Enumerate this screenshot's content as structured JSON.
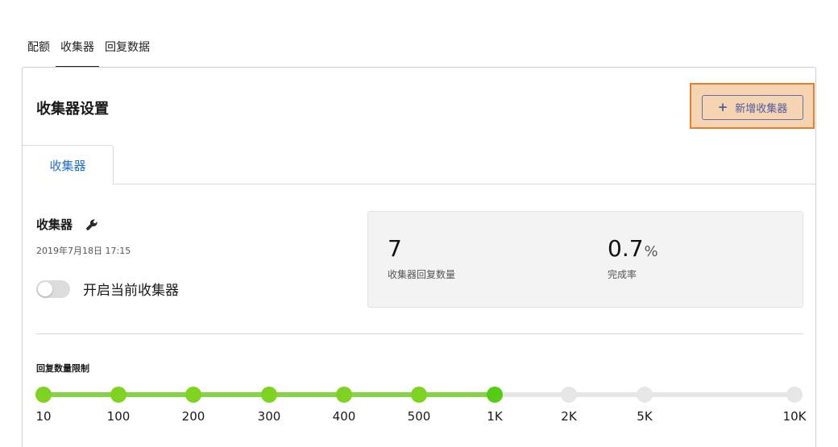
{
  "top_tabs": [
    {
      "label": "配额",
      "active": false
    },
    {
      "label": "收集器",
      "active": true
    },
    {
      "label": "回复数据",
      "active": false
    }
  ],
  "card": {
    "title": "收集器设置",
    "add_button_label": "新增收集器",
    "add_button_icon": "plus-icon"
  },
  "inner_tabs": [
    {
      "label": "收集器",
      "active": true
    }
  ],
  "collector": {
    "name": "收集器",
    "edit_icon": "wrench-icon",
    "date": "2019年7月18日 17:15",
    "toggle_label": "开启当前收集器",
    "toggle_on": false
  },
  "stats": [
    {
      "value": "7",
      "unit": "",
      "label": "收集器回复数量"
    },
    {
      "value": "0.7",
      "unit": "%",
      "label": "完成率"
    }
  ],
  "limit": {
    "title": "回复数量限制",
    "ticks": [
      "10",
      "100",
      "200",
      "300",
      "400",
      "500",
      "1K",
      "2K",
      "5K",
      "10K"
    ],
    "selected_index": 6,
    "colors": {
      "active": "#7ed321",
      "selected": "#54cc14",
      "inactive": "#e6e6e6",
      "track_active": "#86d34a"
    }
  }
}
